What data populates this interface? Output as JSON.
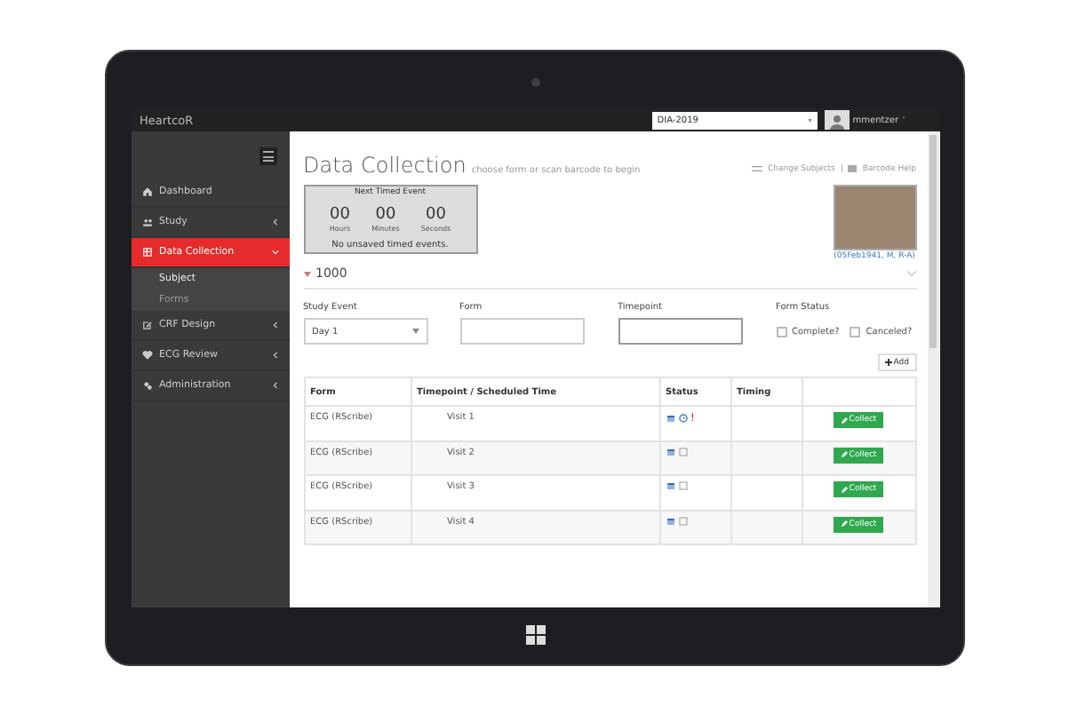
{
  "app": {
    "brand": "HeartcoR",
    "study_select": {
      "value": "DIA-2019",
      "caret": "▾"
    },
    "user": {
      "name": "mmentzer",
      "caret": "˅"
    }
  },
  "sidebar": {
    "items": [
      {
        "label": "Dashboard",
        "selected": false,
        "has_children": false
      },
      {
        "label": "Study",
        "selected": false,
        "expanded": false,
        "has_children": true
      },
      {
        "label": "Data Collection",
        "selected": true,
        "expanded": true,
        "has_children": true,
        "children": [
          {
            "label": "Subject",
            "selected": true
          },
          {
            "label": "Forms",
            "selected": false
          }
        ]
      },
      {
        "label": "CRF Design",
        "selected": false,
        "expanded": false,
        "has_children": true
      },
      {
        "label": "ECG Review",
        "selected": false,
        "expanded": false,
        "has_children": true
      },
      {
        "label": "Administration",
        "selected": false,
        "expanded": false,
        "has_children": true
      }
    ]
  },
  "page": {
    "title": "Data Collection",
    "subtitle": "choose form or scan barcode to begin",
    "links": [
      "Change Subjects",
      "|",
      "Barcode Help"
    ]
  },
  "timer": {
    "title": "Next Timed Event",
    "units": [
      {
        "value": "00",
        "label": "Hours"
      },
      {
        "value": "00",
        "label": "Minutes"
      },
      {
        "value": "00",
        "label": "Seconds"
      }
    ],
    "message": "No unsaved timed events."
  },
  "subject": {
    "info": "(05Feb1941, M, R-A)",
    "id": "1000"
  },
  "filters": {
    "study_event": {
      "label": "Study Event",
      "value": "Day 1"
    },
    "form": {
      "label": "Form"
    },
    "timepoint": {
      "label": "Timepoint"
    },
    "form_status": {
      "label": "Form Status",
      "options": [
        {
          "label": "Complete?",
          "checked": false
        },
        {
          "label": "Canceled?",
          "checked": false
        }
      ]
    }
  },
  "add_button": "Add",
  "table": {
    "columns": [
      "Form",
      "Timepoint / Scheduled Time",
      "Status",
      "Timing",
      ""
    ],
    "rows": [
      {
        "form": "ECG (RScribe)",
        "timepoint": "Visit 1",
        "status": {
          "kind": "timed",
          "flag": "!"
        },
        "action": "Collect"
      },
      {
        "form": "ECG (RScribe)",
        "timepoint": "Visit 2",
        "status": {
          "kind": "untimed"
        },
        "action": "Collect"
      },
      {
        "form": "ECG (RScribe)",
        "timepoint": "Visit 3",
        "status": {
          "kind": "untimed"
        },
        "action": "Collect"
      },
      {
        "form": "ECG (RScribe)",
        "timepoint": "Visit 4",
        "status": {
          "kind": "untimed"
        },
        "action": "Collect"
      }
    ]
  }
}
